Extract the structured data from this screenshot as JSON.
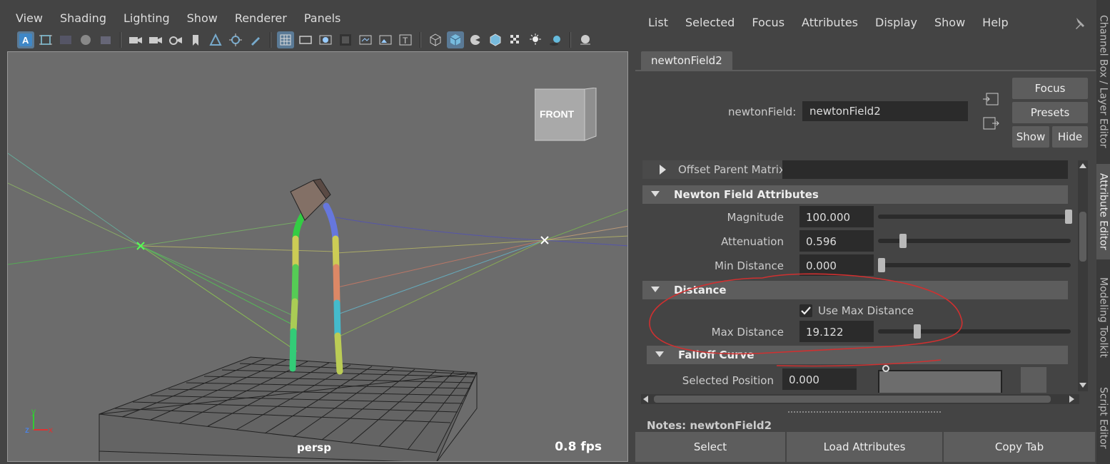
{
  "viewport": {
    "menu": [
      "View",
      "Shading",
      "Lighting",
      "Show",
      "Renderer",
      "Panels"
    ],
    "view_cube_label": "FRONT",
    "camera_name": "persp",
    "fps": "0.8 fps",
    "axis_labels": {
      "x": "x",
      "y": "y",
      "z": "z"
    }
  },
  "ae": {
    "menu": [
      "List",
      "Selected",
      "Focus",
      "Attributes",
      "Display",
      "Show",
      "Help"
    ],
    "tab_name": "newtonField2",
    "node_label": "newtonField:",
    "node_value": "newtonField2",
    "buttons": {
      "focus": "Focus",
      "presets": "Presets",
      "show": "Show",
      "hide": "Hide"
    },
    "offset_parent_matrix": "Offset Parent Matrix",
    "newton_section": "Newton Field Attributes",
    "magnitude_label": "Magnitude",
    "magnitude_value": "100.000",
    "attenuation_label": "Attenuation",
    "attenuation_value": "0.596",
    "min_distance_label": "Min Distance",
    "min_distance_value": "0.000",
    "distance_section": "Distance",
    "use_max_distance_label": "Use Max Distance",
    "use_max_distance_checked": true,
    "max_distance_label": "Max Distance",
    "max_distance_value": "19.122",
    "falloff_section": "Falloff Curve",
    "selected_position_label": "Selected Position",
    "selected_position_value": "0.000",
    "notes_label": "Notes:  newtonField2",
    "bottom_buttons": {
      "select": "Select",
      "load": "Load Attributes",
      "copy": "Copy Tab"
    }
  },
  "side_tabs": {
    "channel_box": "Channel Box / Layer Editor",
    "attribute_editor": "Attribute Editor",
    "modeling_toolkit": "Modeling Toolkit",
    "script_editor": "Script Editor"
  },
  "colors": {
    "annotation_red": "#d03030",
    "selection_blue": "#5a7a96",
    "viewport_bg": "#6c6c6c"
  }
}
